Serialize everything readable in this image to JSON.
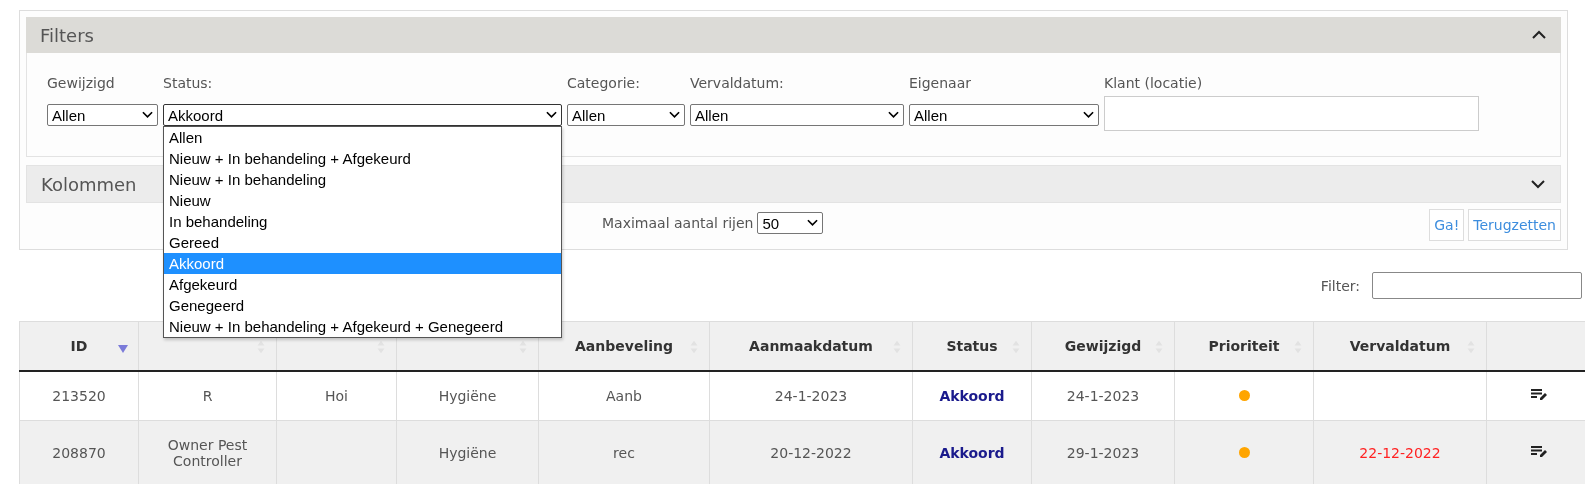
{
  "filters": {
    "title": "Filters",
    "expanded": true,
    "fields": [
      {
        "kind": "select",
        "label": "Gewijzigd",
        "value": "Allen"
      },
      {
        "kind": "select",
        "label": "Status:",
        "value": "Akkoord",
        "open": true,
        "options": [
          {
            "label": "Allen",
            "selected": false
          },
          {
            "label": "Nieuw + In behandeling + Afgekeurd",
            "selected": false
          },
          {
            "label": "Nieuw + In behandeling",
            "selected": false
          },
          {
            "label": "Nieuw",
            "selected": false
          },
          {
            "label": "In behandeling",
            "selected": false
          },
          {
            "label": "Gereed",
            "selected": false
          },
          {
            "label": "Akkoord",
            "selected": true
          },
          {
            "label": "Afgekeurd",
            "selected": false
          },
          {
            "label": "Genegeerd",
            "selected": false
          },
          {
            "label": "Nieuw + In behandeling + Afgekeurd + Genegeerd",
            "selected": false
          }
        ]
      },
      {
        "kind": "select",
        "label": "Categorie:",
        "value": "Allen"
      },
      {
        "kind": "select",
        "label": "Vervaldatum:",
        "value": "Allen"
      },
      {
        "kind": "select",
        "label": "Eigenaar",
        "value": "Allen"
      },
      {
        "kind": "text",
        "label": "Klant (locatie)"
      }
    ]
  },
  "columns_panel": {
    "title": "Kolommen",
    "expanded": false
  },
  "max_rows": {
    "label": "Maximaal aantal rijen",
    "value": "50"
  },
  "buttons": [
    "Ga!",
    "Terugzetten"
  ],
  "search": {
    "label": "Filter:"
  },
  "table": {
    "columns": [
      {
        "label": "ID",
        "sorted": true
      },
      {
        "sorted": false
      },
      {
        "sorted": false
      },
      {
        "sorted": false
      },
      {
        "label": "Aanbeveling",
        "sorted": false
      },
      {
        "label": "Aanmaakdatum",
        "sorted": false
      },
      {
        "label": "Status",
        "sorted": false
      },
      {
        "label": "Gewijzigd",
        "sorted": false
      },
      {
        "label": "Prioriteit",
        "sorted": false
      },
      {
        "label": "Vervaldatum",
        "sorted": false
      },
      {}
    ],
    "rows": [
      {
        "id": "213520",
        "klant": "R",
        "label": "Hoi",
        "categorie": "Hygiëne",
        "aanbeveling": "Aanb",
        "aanmaakdatum": "24-1-2023",
        "status": "Akkoord",
        "gewijzigd": "24-1-2023",
        "color": "#ffa500"
      },
      {
        "id": "208870",
        "klant": "Owner Pest Controller",
        "categorie": "Hygiëne",
        "aanbeveling": "rec",
        "aanmaakdatum": "20-12-2022",
        "status": "Akkoord",
        "gewijzigd": "29-1-2023",
        "color": "#ffa500",
        "vervaldatum": "22-12-2022",
        "overdue": true
      }
    ]
  }
}
